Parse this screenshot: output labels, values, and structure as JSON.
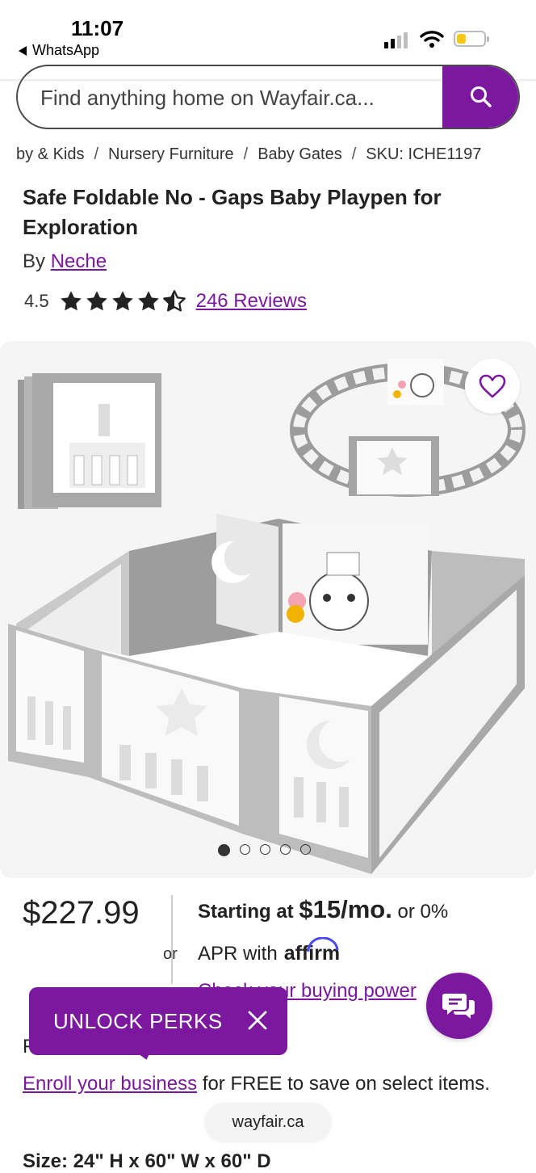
{
  "status_bar": {
    "time": "11:07",
    "back_app": "WhatsApp"
  },
  "search": {
    "placeholder": "Find anything home on Wayfair.ca...",
    "button_icon": "search-icon"
  },
  "breadcrumb": [
    "by & Kids",
    "Nursery Furniture",
    "Baby Gates",
    "SKU: ICHE1197"
  ],
  "product": {
    "title": "Safe Foldable No - Gaps Baby Playpen for Exploration",
    "by_prefix": "By",
    "brand": "Neche",
    "rating": "4.5",
    "rating_value": 4.5,
    "reviews": "246 Reviews"
  },
  "gallery": {
    "image_count": 5,
    "active_index": 0,
    "wishlist_icon": "heart-icon"
  },
  "pricing": {
    "price": "$227.99",
    "or_label": "or",
    "starting_at": "Starting at",
    "monthly": "$15/mo.",
    "apr_suffix": "or 0%",
    "apr_line": "APR with",
    "affirm": "affirm",
    "check_link": "Check your buying power"
  },
  "pro": {
    "label": "F",
    "enroll_link": "Enroll your business",
    "enroll_text": "for FREE to save on select items."
  },
  "size_line": "Size: 24\" H x 60\" W x 60\" D",
  "perks": {
    "label": "UNLOCK PERKS"
  },
  "browser": {
    "url": "wayfair.ca"
  },
  "colors": {
    "brand_purple": "#7b189f",
    "gallery_bg": "#f5f5f5"
  }
}
